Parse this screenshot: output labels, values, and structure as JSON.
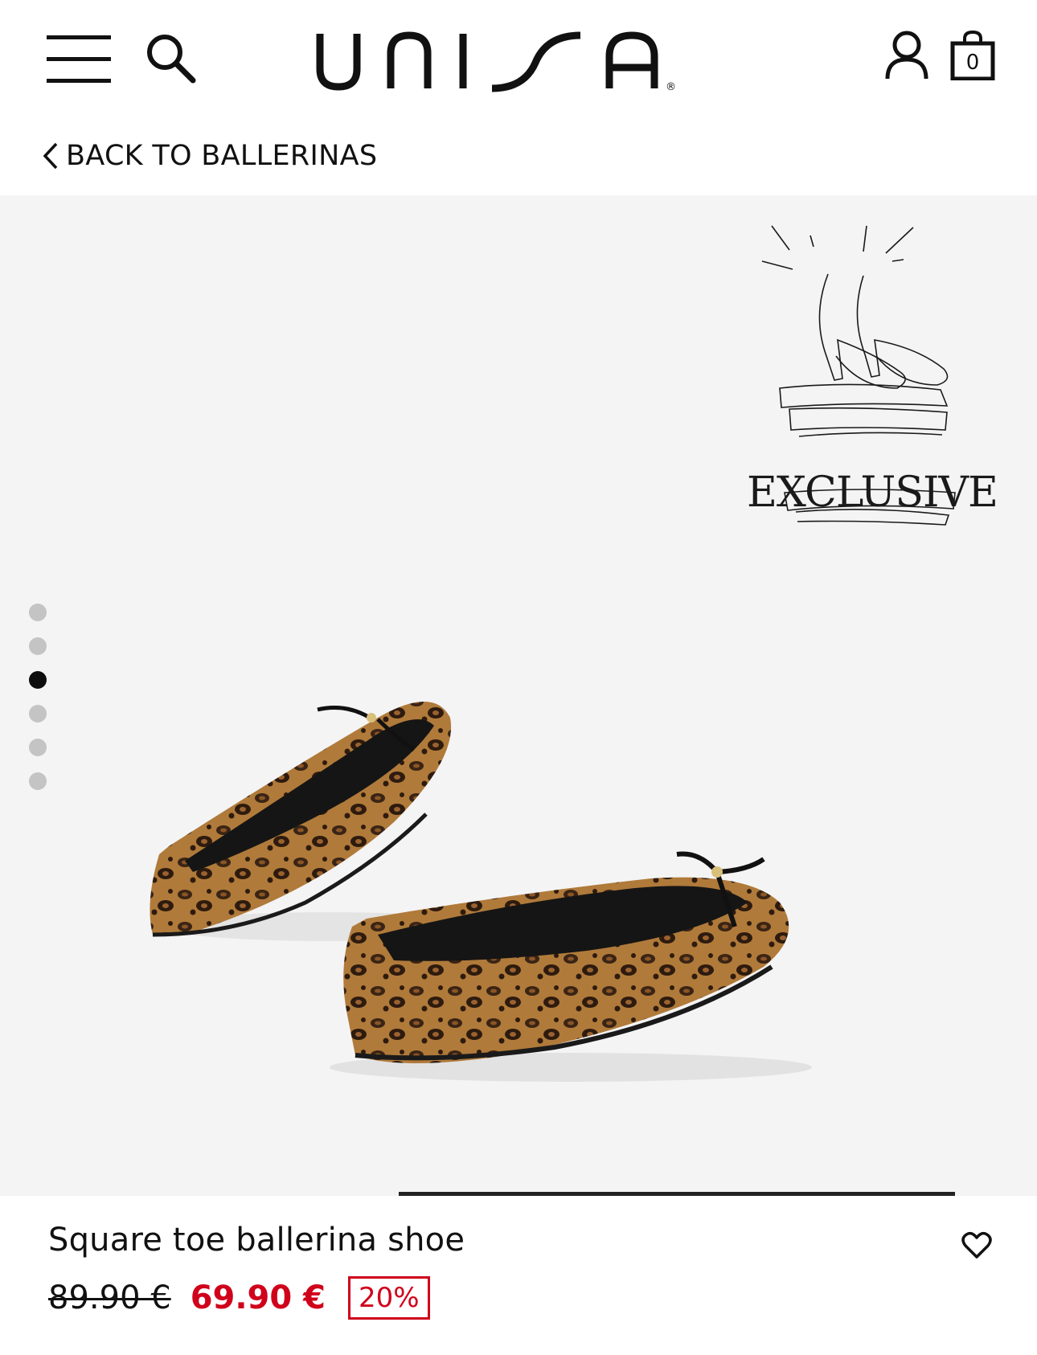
{
  "header": {
    "brand": "UNISA",
    "cart_count": "0",
    "icons": [
      "menu-icon",
      "search-icon",
      "account-icon",
      "shopping-bag-icon"
    ]
  },
  "nav": {
    "back_label": "BACK TO BALLERINAS"
  },
  "gallery": {
    "badge_text": "EXCLUSIVE",
    "image_count": 6,
    "active_index": 2
  },
  "product": {
    "name": "Square toe ballerina shoe",
    "old_price": "89.90 €",
    "new_price": "69.90 €",
    "discount": "20%"
  },
  "colors": {
    "sale_red": "#d0021b",
    "gallery_bg": "#f4f4f4",
    "dot_inactive": "#c4c4c4",
    "dot_active": "#0d0d0d"
  }
}
